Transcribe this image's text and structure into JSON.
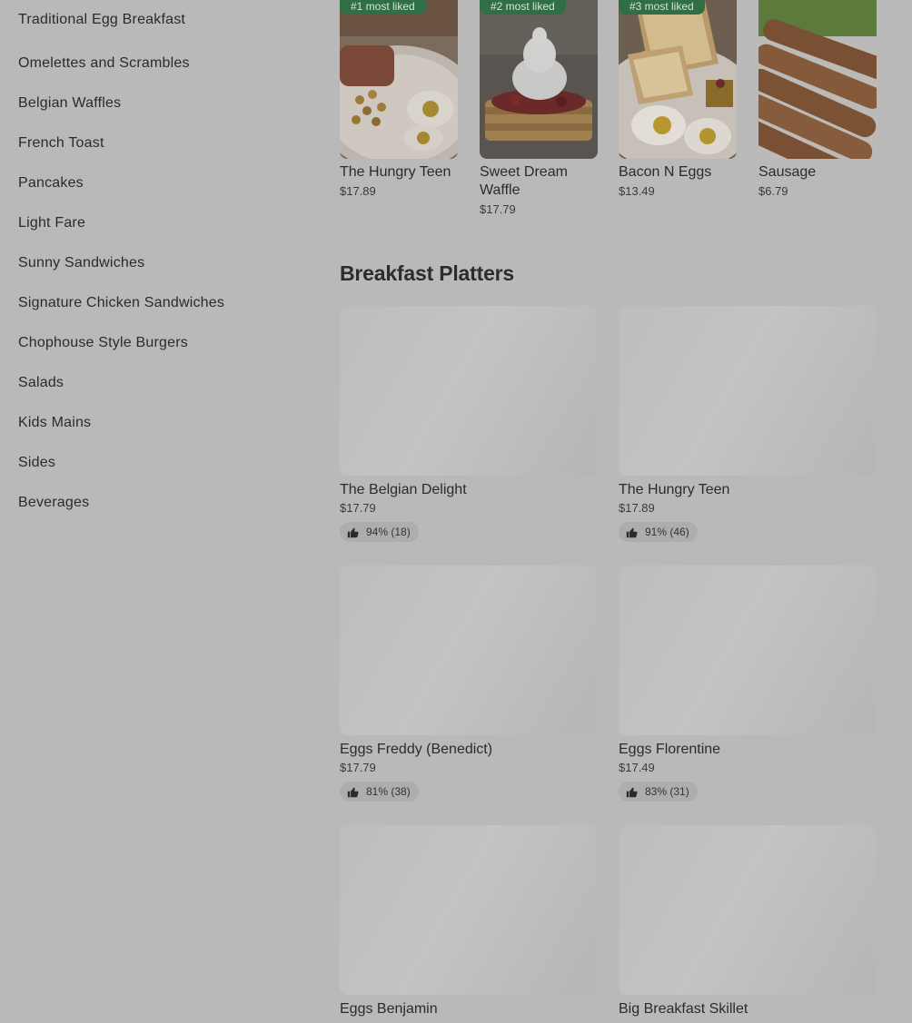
{
  "sidebar": {
    "items": [
      "Traditional Egg Breakfast",
      "Omelettes and Scrambles",
      "Belgian Waffles",
      "French Toast",
      "Pancakes",
      "Light Fare",
      "Sunny Sandwiches",
      "Signature Chicken Sandwiches",
      "Chophouse Style Burgers",
      "Salads",
      "Kids Mains",
      "Sides",
      "Beverages"
    ]
  },
  "most_liked": [
    {
      "badge": "#1 most liked",
      "name": "The Hungry Teen",
      "price": "$17.89"
    },
    {
      "badge": "#2 most liked",
      "name": "Sweet Dream Waffle",
      "price": "$17.79"
    },
    {
      "badge": "#3 most liked",
      "name": "Bacon N Eggs",
      "price": "$13.49"
    },
    {
      "badge": "",
      "name": "Sausage",
      "price": "$6.79"
    }
  ],
  "section": {
    "title": "Breakfast Platters",
    "items": [
      {
        "name": "The Belgian Delight",
        "price": "$17.79",
        "rating": "94% (18)"
      },
      {
        "name": "The Hungry Teen",
        "price": "$17.89",
        "rating": "91% (46)"
      },
      {
        "name": "Eggs Freddy (Benedict)",
        "price": "$17.79",
        "rating": "81% (38)"
      },
      {
        "name": "Eggs Florentine",
        "price": "$17.49",
        "rating": "83% (31)"
      },
      {
        "name": "Eggs Benjamin",
        "price": "",
        "rating": ""
      },
      {
        "name": "Big Breakfast Skillet",
        "price": "",
        "rating": ""
      }
    ]
  },
  "colors": {
    "overlay_background": "#b9b9b9",
    "badge_green": "#2f6e46",
    "rating_pill": "#adadad"
  },
  "icons": {
    "rating": "thumbs-up-icon"
  }
}
